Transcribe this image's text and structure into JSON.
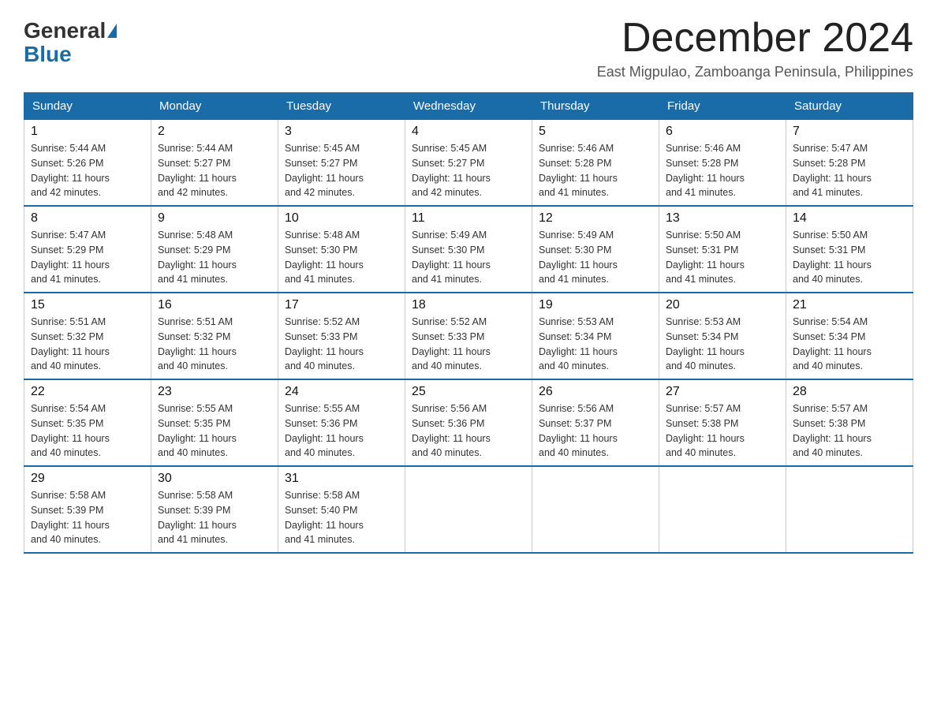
{
  "logo": {
    "general": "General",
    "blue": "Blue"
  },
  "header": {
    "title": "December 2024",
    "subtitle": "East Migpulao, Zamboanga Peninsula, Philippines"
  },
  "weekdays": [
    "Sunday",
    "Monday",
    "Tuesday",
    "Wednesday",
    "Thursday",
    "Friday",
    "Saturday"
  ],
  "weeks": [
    [
      {
        "day": "1",
        "sunrise": "5:44 AM",
        "sunset": "5:26 PM",
        "daylight": "11 hours and 42 minutes."
      },
      {
        "day": "2",
        "sunrise": "5:44 AM",
        "sunset": "5:27 PM",
        "daylight": "11 hours and 42 minutes."
      },
      {
        "day": "3",
        "sunrise": "5:45 AM",
        "sunset": "5:27 PM",
        "daylight": "11 hours and 42 minutes."
      },
      {
        "day": "4",
        "sunrise": "5:45 AM",
        "sunset": "5:27 PM",
        "daylight": "11 hours and 42 minutes."
      },
      {
        "day": "5",
        "sunrise": "5:46 AM",
        "sunset": "5:28 PM",
        "daylight": "11 hours and 41 minutes."
      },
      {
        "day": "6",
        "sunrise": "5:46 AM",
        "sunset": "5:28 PM",
        "daylight": "11 hours and 41 minutes."
      },
      {
        "day": "7",
        "sunrise": "5:47 AM",
        "sunset": "5:28 PM",
        "daylight": "11 hours and 41 minutes."
      }
    ],
    [
      {
        "day": "8",
        "sunrise": "5:47 AM",
        "sunset": "5:29 PM",
        "daylight": "11 hours and 41 minutes."
      },
      {
        "day": "9",
        "sunrise": "5:48 AM",
        "sunset": "5:29 PM",
        "daylight": "11 hours and 41 minutes."
      },
      {
        "day": "10",
        "sunrise": "5:48 AM",
        "sunset": "5:30 PM",
        "daylight": "11 hours and 41 minutes."
      },
      {
        "day": "11",
        "sunrise": "5:49 AM",
        "sunset": "5:30 PM",
        "daylight": "11 hours and 41 minutes."
      },
      {
        "day": "12",
        "sunrise": "5:49 AM",
        "sunset": "5:30 PM",
        "daylight": "11 hours and 41 minutes."
      },
      {
        "day": "13",
        "sunrise": "5:50 AM",
        "sunset": "5:31 PM",
        "daylight": "11 hours and 41 minutes."
      },
      {
        "day": "14",
        "sunrise": "5:50 AM",
        "sunset": "5:31 PM",
        "daylight": "11 hours and 40 minutes."
      }
    ],
    [
      {
        "day": "15",
        "sunrise": "5:51 AM",
        "sunset": "5:32 PM",
        "daylight": "11 hours and 40 minutes."
      },
      {
        "day": "16",
        "sunrise": "5:51 AM",
        "sunset": "5:32 PM",
        "daylight": "11 hours and 40 minutes."
      },
      {
        "day": "17",
        "sunrise": "5:52 AM",
        "sunset": "5:33 PM",
        "daylight": "11 hours and 40 minutes."
      },
      {
        "day": "18",
        "sunrise": "5:52 AM",
        "sunset": "5:33 PM",
        "daylight": "11 hours and 40 minutes."
      },
      {
        "day": "19",
        "sunrise": "5:53 AM",
        "sunset": "5:34 PM",
        "daylight": "11 hours and 40 minutes."
      },
      {
        "day": "20",
        "sunrise": "5:53 AM",
        "sunset": "5:34 PM",
        "daylight": "11 hours and 40 minutes."
      },
      {
        "day": "21",
        "sunrise": "5:54 AM",
        "sunset": "5:34 PM",
        "daylight": "11 hours and 40 minutes."
      }
    ],
    [
      {
        "day": "22",
        "sunrise": "5:54 AM",
        "sunset": "5:35 PM",
        "daylight": "11 hours and 40 minutes."
      },
      {
        "day": "23",
        "sunrise": "5:55 AM",
        "sunset": "5:35 PM",
        "daylight": "11 hours and 40 minutes."
      },
      {
        "day": "24",
        "sunrise": "5:55 AM",
        "sunset": "5:36 PM",
        "daylight": "11 hours and 40 minutes."
      },
      {
        "day": "25",
        "sunrise": "5:56 AM",
        "sunset": "5:36 PM",
        "daylight": "11 hours and 40 minutes."
      },
      {
        "day": "26",
        "sunrise": "5:56 AM",
        "sunset": "5:37 PM",
        "daylight": "11 hours and 40 minutes."
      },
      {
        "day": "27",
        "sunrise": "5:57 AM",
        "sunset": "5:38 PM",
        "daylight": "11 hours and 40 minutes."
      },
      {
        "day": "28",
        "sunrise": "5:57 AM",
        "sunset": "5:38 PM",
        "daylight": "11 hours and 40 minutes."
      }
    ],
    [
      {
        "day": "29",
        "sunrise": "5:58 AM",
        "sunset": "5:39 PM",
        "daylight": "11 hours and 40 minutes."
      },
      {
        "day": "30",
        "sunrise": "5:58 AM",
        "sunset": "5:39 PM",
        "daylight": "11 hours and 41 minutes."
      },
      {
        "day": "31",
        "sunrise": "5:58 AM",
        "sunset": "5:40 PM",
        "daylight": "11 hours and 41 minutes."
      },
      null,
      null,
      null,
      null
    ]
  ],
  "labels": {
    "sunrise": "Sunrise:",
    "sunset": "Sunset:",
    "daylight": "Daylight:"
  }
}
